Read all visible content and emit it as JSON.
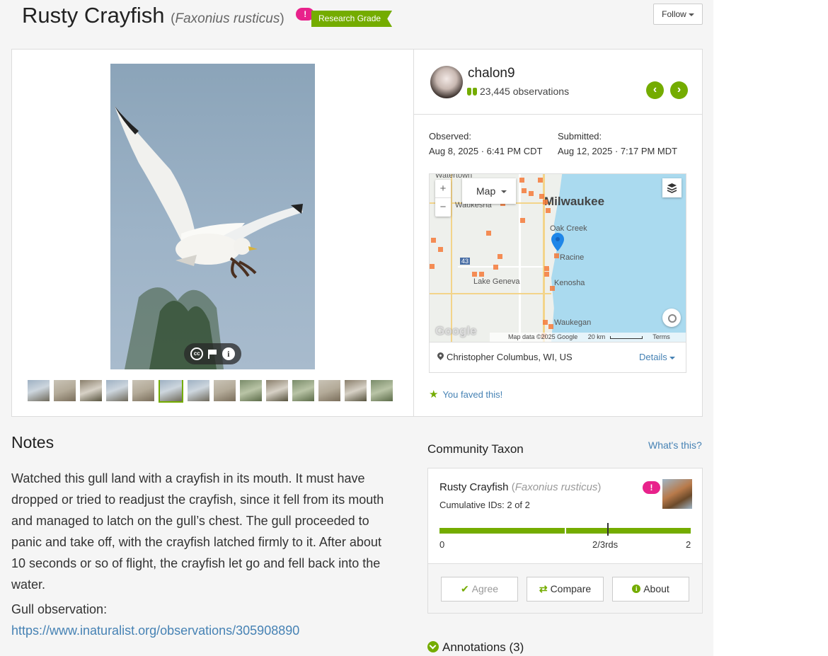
{
  "header": {
    "common_name": "Rusty Crayfish",
    "scientific_name": "Faxonius rusticus",
    "alert_glyph": "!",
    "quality_grade": "Research Grade",
    "follow_label": "Follow"
  },
  "photos": {
    "thumbnail_count": 14,
    "active_index": 5
  },
  "observer": {
    "username": "chalon9",
    "observation_count": "23,445 observations",
    "prev_glyph": "‹",
    "next_glyph": "›"
  },
  "dates": {
    "observed_label": "Observed:",
    "observed_value": "Aug 8, 2025 · 6:41 PM CDT",
    "submitted_label": "Submitted:",
    "submitted_value": "Aug 12, 2025 · 7:17 PM MDT"
  },
  "map": {
    "type_label": "Map",
    "zoom_in": "+",
    "zoom_out": "−",
    "labels": {
      "milwaukee": "Milwaukee",
      "waukesha": "Waukesha",
      "oak_creek": "Oak Creek",
      "racine": "Racine",
      "lake_geneva": "Lake Geneva",
      "kenosha": "Kenosha",
      "waukegan": "Waukegan",
      "watertown": "Watertown",
      "hwy43": "43"
    },
    "google_logo": "Google",
    "attribution": "Map data ©2025 Google",
    "scale": "20 km",
    "terms": "Terms",
    "place": "Christopher Columbus, WI, US",
    "details_label": "Details"
  },
  "faved_text": "You faved this!",
  "notes": {
    "title": "Notes",
    "body": "Watched this gull land with a crayfish in its mouth. It must have dropped or tried to readjust the crayfish, since it fell from its mouth and managed to latch on the gull’s chest. The gull proceeded to panic and take off, with the crayfish latched firmly to it. After about 10 seconds or so of flight, the crayfish let go and fell back into the water.",
    "gull_label": "Gull observation:",
    "gull_link": "https://www.inaturalist.org/observations/305908890"
  },
  "community_taxon": {
    "title": "Community Taxon",
    "whats_this": "What's this?",
    "common_name": "Rusty Crayfish",
    "scientific_name": "Faxonius rusticus",
    "cumulative_ids": "Cumulative IDs: 2 of 2",
    "scale_min": "0",
    "scale_mid": "2/3rds",
    "scale_max": "2",
    "agree_label": "Agree",
    "compare_label": "Compare",
    "about_label": "About"
  },
  "annotations_label": "Annotations (3)",
  "colors": {
    "accent_green": "#74ac00",
    "alert_pink": "#e8228b",
    "link_blue": "#4682b4"
  }
}
